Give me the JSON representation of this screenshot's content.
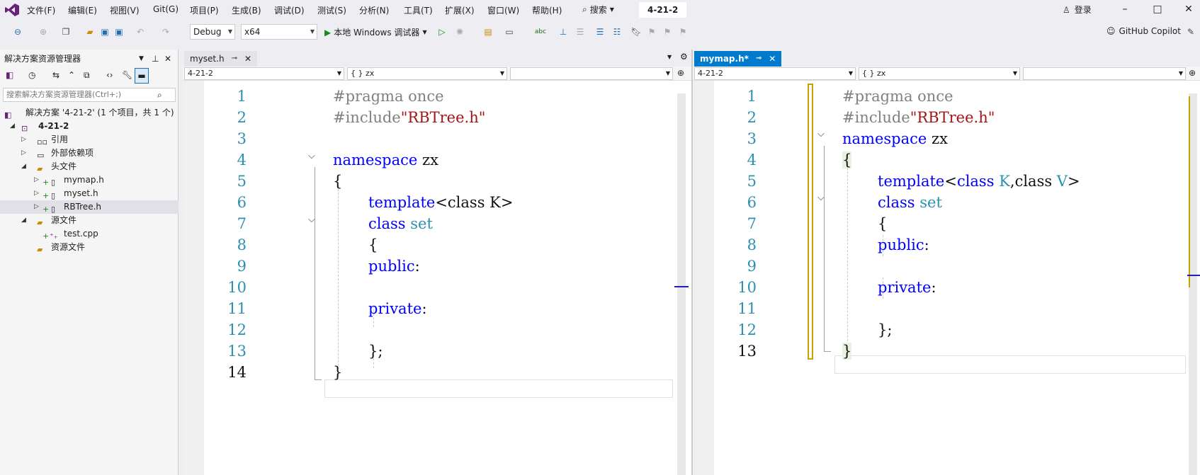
{
  "menu": [
    "文件(F)",
    "编辑(E)",
    "视图(V)",
    "Git(G)",
    "项目(P)",
    "生成(B)",
    "调试(D)",
    "测试(S)",
    "分析(N)",
    "工具(T)",
    "扩展(X)",
    "窗口(W)",
    "帮助(H)"
  ],
  "search_label": "搜索",
  "project_title": "4-21-2",
  "login_label": "登录",
  "toolbar": {
    "config": "Debug",
    "platform": "x64",
    "run_label": "本地 Windows 调试器",
    "copilot_label": "GitHub Copilot"
  },
  "solution_explorer": {
    "title": "解决方案资源管理器",
    "search_placeholder": "搜索解决方案资源管理器(Ctrl+;)",
    "items": [
      {
        "label": "解决方案 '4-21-2' (1 个项目，共 1 个)"
      },
      {
        "label": "4-21-2"
      },
      {
        "label": "引用"
      },
      {
        "label": "外部依赖项"
      },
      {
        "label": "头文件"
      },
      {
        "label": "mymap.h"
      },
      {
        "label": "myset.h"
      },
      {
        "label": "RBTree.h"
      },
      {
        "label": "源文件"
      },
      {
        "label": "test.cpp"
      },
      {
        "label": "资源文件"
      }
    ]
  },
  "left_editor": {
    "tab": "myset.h",
    "nav_project": "4-21-2",
    "nav_scope": "{ } zx",
    "lines": [
      "1",
      "2",
      "3",
      "4",
      "5",
      "6",
      "7",
      "8",
      "9",
      "10",
      "11",
      "12",
      "13",
      "14"
    ]
  },
  "right_editor": {
    "tab": "mymap.h*",
    "nav_project": "4-21-2",
    "nav_scope": "{ } zx",
    "lines": [
      "1",
      "2",
      "3",
      "4",
      "5",
      "6",
      "7",
      "8",
      "9",
      "10",
      "11",
      "12",
      "13"
    ]
  },
  "code": {
    "pragma": "#pragma once",
    "include_dir": "#include",
    "include_file": "\"RBTree.h\"",
    "namespace_kw": "namespace",
    "namespace_name": " zx",
    "open_brace": "{",
    "close_brace": "}",
    "close_class": "};",
    "template_kw": "template",
    "template_set_args": "<class K>",
    "template_map_open": "<",
    "class_kw": "class",
    "k_type": "K",
    "v_type": "V",
    "comma_class": ",class ",
    "close_angle": ">",
    "set_name": "set",
    "public_kw": "public",
    "private_kw": "private",
    "colon": ":"
  },
  "colors": {
    "keyword": "#0000ff",
    "type": "#2b91af",
    "string": "#a31515",
    "preprocessor": "#808080",
    "active_tab": "#007acc",
    "accent": "#68217a"
  }
}
